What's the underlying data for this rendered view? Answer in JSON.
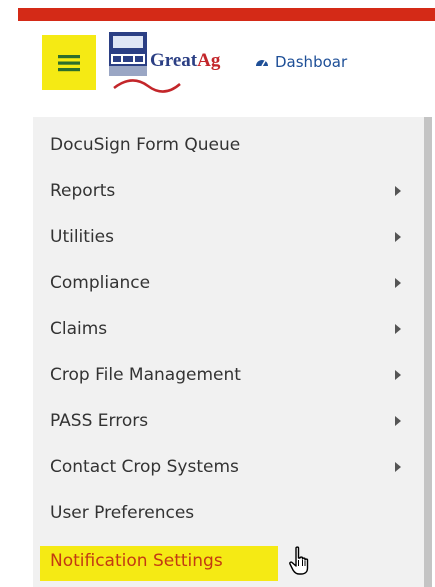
{
  "header": {
    "brand_part1": "Great",
    "brand_part2": "Ag",
    "dashboard_label": "Dashboar"
  },
  "menu": {
    "items": [
      {
        "label": "DocuSign Form Queue",
        "has_submenu": false
      },
      {
        "label": "Reports",
        "has_submenu": true
      },
      {
        "label": "Utilities",
        "has_submenu": true
      },
      {
        "label": "Compliance",
        "has_submenu": true
      },
      {
        "label": "Claims",
        "has_submenu": true
      },
      {
        "label": "Crop File Management",
        "has_submenu": true
      },
      {
        "label": "PASS Errors",
        "has_submenu": true
      },
      {
        "label": "Contact Crop Systems",
        "has_submenu": true
      },
      {
        "label": "User Preferences",
        "has_submenu": false
      },
      {
        "label": "Notification Settings",
        "has_submenu": false,
        "highlighted": true
      }
    ]
  },
  "colors": {
    "top_bar": "#d42a17",
    "highlight": "#f5ea14",
    "highlight_text": "#c33a12",
    "brand_blue": "#2b3f84",
    "brand_red": "#c3262a"
  },
  "icons": {
    "menu_toggle": "hamburger-icon",
    "dashboard": "dashboard-gauge-icon",
    "submenu": "caret-right-icon",
    "cursor": "hand-pointer-icon"
  }
}
